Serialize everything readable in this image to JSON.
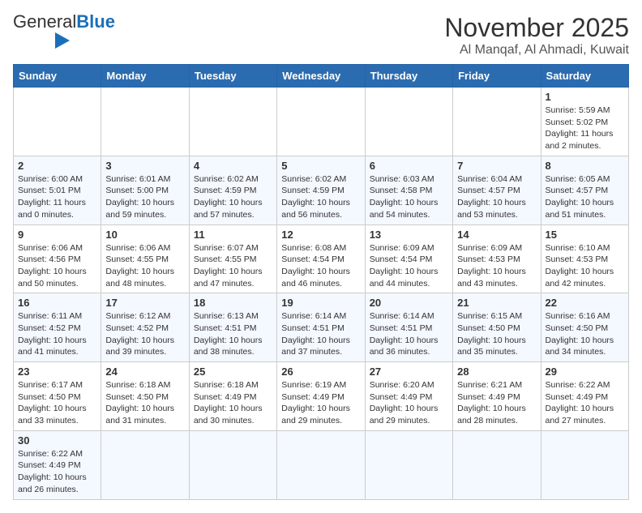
{
  "header": {
    "logo_general": "General",
    "logo_blue": "Blue",
    "month_year": "November 2025",
    "location": "Al Manqaf, Al Ahmadi, Kuwait"
  },
  "weekdays": [
    "Sunday",
    "Monday",
    "Tuesday",
    "Wednesday",
    "Thursday",
    "Friday",
    "Saturday"
  ],
  "weeks": [
    [
      {
        "day": "",
        "info": ""
      },
      {
        "day": "",
        "info": ""
      },
      {
        "day": "",
        "info": ""
      },
      {
        "day": "",
        "info": ""
      },
      {
        "day": "",
        "info": ""
      },
      {
        "day": "",
        "info": ""
      },
      {
        "day": "1",
        "info": "Sunrise: 5:59 AM\nSunset: 5:02 PM\nDaylight: 11 hours and 2 minutes."
      }
    ],
    [
      {
        "day": "2",
        "info": "Sunrise: 6:00 AM\nSunset: 5:01 PM\nDaylight: 11 hours and 0 minutes."
      },
      {
        "day": "3",
        "info": "Sunrise: 6:01 AM\nSunset: 5:00 PM\nDaylight: 10 hours and 59 minutes."
      },
      {
        "day": "4",
        "info": "Sunrise: 6:02 AM\nSunset: 4:59 PM\nDaylight: 10 hours and 57 minutes."
      },
      {
        "day": "5",
        "info": "Sunrise: 6:02 AM\nSunset: 4:59 PM\nDaylight: 10 hours and 56 minutes."
      },
      {
        "day": "6",
        "info": "Sunrise: 6:03 AM\nSunset: 4:58 PM\nDaylight: 10 hours and 54 minutes."
      },
      {
        "day": "7",
        "info": "Sunrise: 6:04 AM\nSunset: 4:57 PM\nDaylight: 10 hours and 53 minutes."
      },
      {
        "day": "8",
        "info": "Sunrise: 6:05 AM\nSunset: 4:57 PM\nDaylight: 10 hours and 51 minutes."
      }
    ],
    [
      {
        "day": "9",
        "info": "Sunrise: 6:06 AM\nSunset: 4:56 PM\nDaylight: 10 hours and 50 minutes."
      },
      {
        "day": "10",
        "info": "Sunrise: 6:06 AM\nSunset: 4:55 PM\nDaylight: 10 hours and 48 minutes."
      },
      {
        "day": "11",
        "info": "Sunrise: 6:07 AM\nSunset: 4:55 PM\nDaylight: 10 hours and 47 minutes."
      },
      {
        "day": "12",
        "info": "Sunrise: 6:08 AM\nSunset: 4:54 PM\nDaylight: 10 hours and 46 minutes."
      },
      {
        "day": "13",
        "info": "Sunrise: 6:09 AM\nSunset: 4:54 PM\nDaylight: 10 hours and 44 minutes."
      },
      {
        "day": "14",
        "info": "Sunrise: 6:09 AM\nSunset: 4:53 PM\nDaylight: 10 hours and 43 minutes."
      },
      {
        "day": "15",
        "info": "Sunrise: 6:10 AM\nSunset: 4:53 PM\nDaylight: 10 hours and 42 minutes."
      }
    ],
    [
      {
        "day": "16",
        "info": "Sunrise: 6:11 AM\nSunset: 4:52 PM\nDaylight: 10 hours and 41 minutes."
      },
      {
        "day": "17",
        "info": "Sunrise: 6:12 AM\nSunset: 4:52 PM\nDaylight: 10 hours and 39 minutes."
      },
      {
        "day": "18",
        "info": "Sunrise: 6:13 AM\nSunset: 4:51 PM\nDaylight: 10 hours and 38 minutes."
      },
      {
        "day": "19",
        "info": "Sunrise: 6:14 AM\nSunset: 4:51 PM\nDaylight: 10 hours and 37 minutes."
      },
      {
        "day": "20",
        "info": "Sunrise: 6:14 AM\nSunset: 4:51 PM\nDaylight: 10 hours and 36 minutes."
      },
      {
        "day": "21",
        "info": "Sunrise: 6:15 AM\nSunset: 4:50 PM\nDaylight: 10 hours and 35 minutes."
      },
      {
        "day": "22",
        "info": "Sunrise: 6:16 AM\nSunset: 4:50 PM\nDaylight: 10 hours and 34 minutes."
      }
    ],
    [
      {
        "day": "23",
        "info": "Sunrise: 6:17 AM\nSunset: 4:50 PM\nDaylight: 10 hours and 33 minutes."
      },
      {
        "day": "24",
        "info": "Sunrise: 6:18 AM\nSunset: 4:50 PM\nDaylight: 10 hours and 31 minutes."
      },
      {
        "day": "25",
        "info": "Sunrise: 6:18 AM\nSunset: 4:49 PM\nDaylight: 10 hours and 30 minutes."
      },
      {
        "day": "26",
        "info": "Sunrise: 6:19 AM\nSunset: 4:49 PM\nDaylight: 10 hours and 29 minutes."
      },
      {
        "day": "27",
        "info": "Sunrise: 6:20 AM\nSunset: 4:49 PM\nDaylight: 10 hours and 29 minutes."
      },
      {
        "day": "28",
        "info": "Sunrise: 6:21 AM\nSunset: 4:49 PM\nDaylight: 10 hours and 28 minutes."
      },
      {
        "day": "29",
        "info": "Sunrise: 6:22 AM\nSunset: 4:49 PM\nDaylight: 10 hours and 27 minutes."
      }
    ],
    [
      {
        "day": "30",
        "info": "Sunrise: 6:22 AM\nSunset: 4:49 PM\nDaylight: 10 hours and 26 minutes."
      },
      {
        "day": "",
        "info": ""
      },
      {
        "day": "",
        "info": ""
      },
      {
        "day": "",
        "info": ""
      },
      {
        "day": "",
        "info": ""
      },
      {
        "day": "",
        "info": ""
      },
      {
        "day": "",
        "info": ""
      }
    ]
  ]
}
